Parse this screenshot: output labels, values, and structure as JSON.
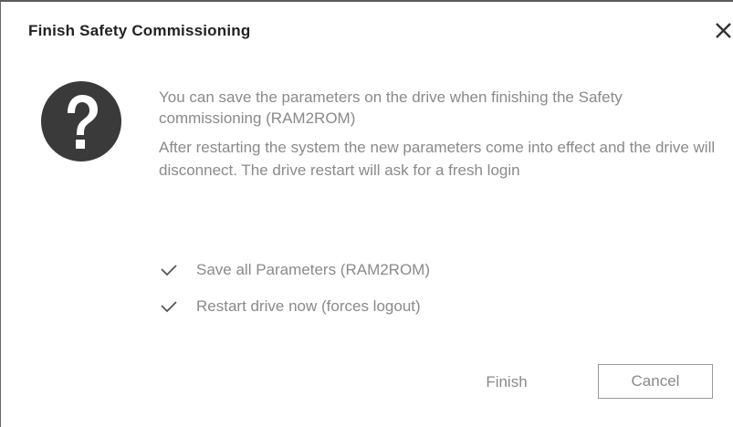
{
  "dialog": {
    "title": "Finish Safety Commissioning",
    "close_icon": "close-icon",
    "help_icon": "question-mark-icon",
    "message": {
      "paragraph1": "You can save the parameters on the drive when finishing the Safety commissioning (RAM2ROM)",
      "paragraph2": "After restarting the system the new parameters come into effect and the drive will disconnect. The drive restart will ask for a fresh login"
    },
    "options": [
      {
        "label": "Save all Parameters (RAM2ROM)",
        "checked": true,
        "icon": "checkmark-icon"
      },
      {
        "label": "Restart drive now (forces logout)",
        "checked": true,
        "icon": "checkmark-icon"
      }
    ],
    "buttons": {
      "finish": "Finish",
      "cancel": "Cancel"
    }
  }
}
